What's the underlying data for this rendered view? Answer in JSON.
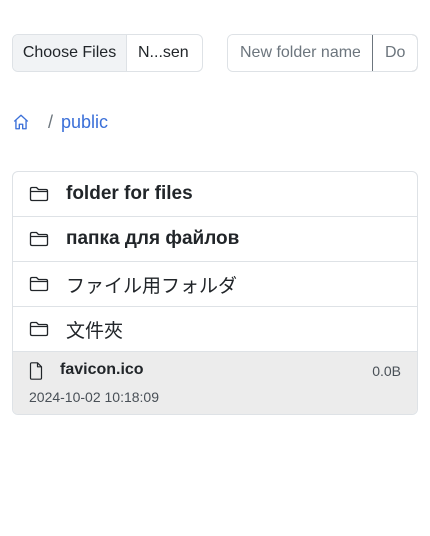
{
  "upload": {
    "choose_label": "Choose Files",
    "file_status": "N...sen"
  },
  "new_folder": {
    "placeholder": "New folder name",
    "button_label": "Do"
  },
  "breadcrumb": {
    "home_icon": "home-icon",
    "separator": "/",
    "current": "public"
  },
  "entries": {
    "folders": [
      {
        "name": "folder for files",
        "icon": "folder-icon",
        "bold": true
      },
      {
        "name": "папка для файлов",
        "icon": "folder-icon",
        "bold": true
      },
      {
        "name": "ファイル用フォルダ",
        "icon": "folder-icon",
        "bold": false
      },
      {
        "name": "文件夾",
        "icon": "folder-icon",
        "bold": false
      }
    ],
    "file": {
      "name": "favicon.ico",
      "size": "0.0B",
      "modified": "2024-10-02 10:18:09",
      "icon": "file-icon"
    }
  },
  "colors": {
    "link": "#3a6fd8",
    "border": "#dee2e6",
    "selected_bg": "#ececec"
  }
}
